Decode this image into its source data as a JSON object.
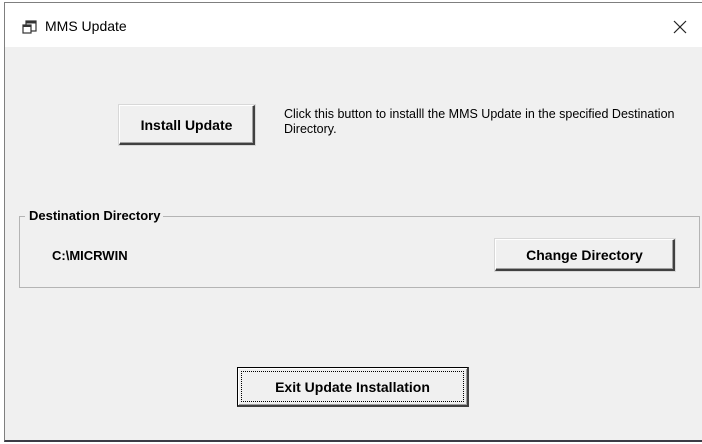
{
  "window": {
    "title": "MMS Update",
    "close_glyph": "×"
  },
  "install": {
    "button_label": "Install Update",
    "description": "Click this button to installl the MMS Update in the specified Destination Directory."
  },
  "destination": {
    "group_label": "Destination Directory",
    "path": "C:\\MICRWIN",
    "change_button_label": "Change Directory"
  },
  "exit": {
    "button_label": "Exit Update Installation"
  },
  "icons": {
    "title": "app-window-icon",
    "close": "close-icon"
  }
}
